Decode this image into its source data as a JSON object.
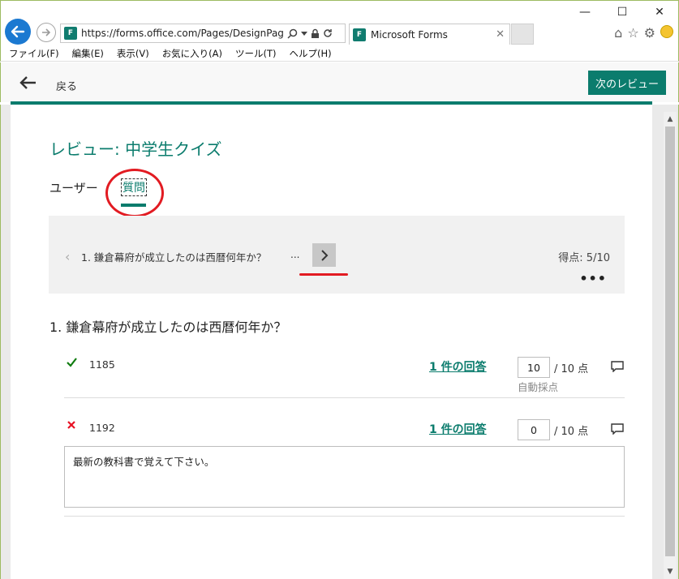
{
  "browser": {
    "url": "https://forms.office.com/Pages/DesignPage.aspx",
    "tab_title": "Microsoft Forms",
    "favicon_letter": "F",
    "window_controls": {
      "minimize": "—",
      "maximize": "☐",
      "close": "✕"
    },
    "menu": [
      "ファイル(F)",
      "編集(E)",
      "表示(V)",
      "お気に入り(A)",
      "ツール(T)",
      "ヘルプ(H)"
    ]
  },
  "header": {
    "back_label": "戻る",
    "next_review_label": "次のレビュー"
  },
  "review": {
    "title": "レビュー: 中学生クイズ",
    "tabs": {
      "users": "ユーザー",
      "questions": "質問"
    }
  },
  "question_nav": {
    "text": "1. 鎌倉幕府が成立したのは西暦何年か？",
    "ellipsis": "...",
    "score": "得点: 5/10",
    "more": "•••"
  },
  "question": {
    "heading": "1. 鎌倉幕府が成立したのは西暦何年か？",
    "responses": [
      {
        "correct": true,
        "answer": "1185",
        "count_label": "1 件の回答",
        "score": "10",
        "max": "/ 10 点",
        "auto_label": "自動採点"
      },
      {
        "correct": false,
        "answer": "1192",
        "count_label": "1 件の回答",
        "score": "0",
        "max": "/ 10 点",
        "feedback": "最新の教科書で覚えて下さい。"
      }
    ]
  },
  "colors": {
    "brand": "#0b7c6d",
    "annotation_red": "#e21b22",
    "correct_green": "#107c10",
    "wrong_red": "#e81123"
  }
}
